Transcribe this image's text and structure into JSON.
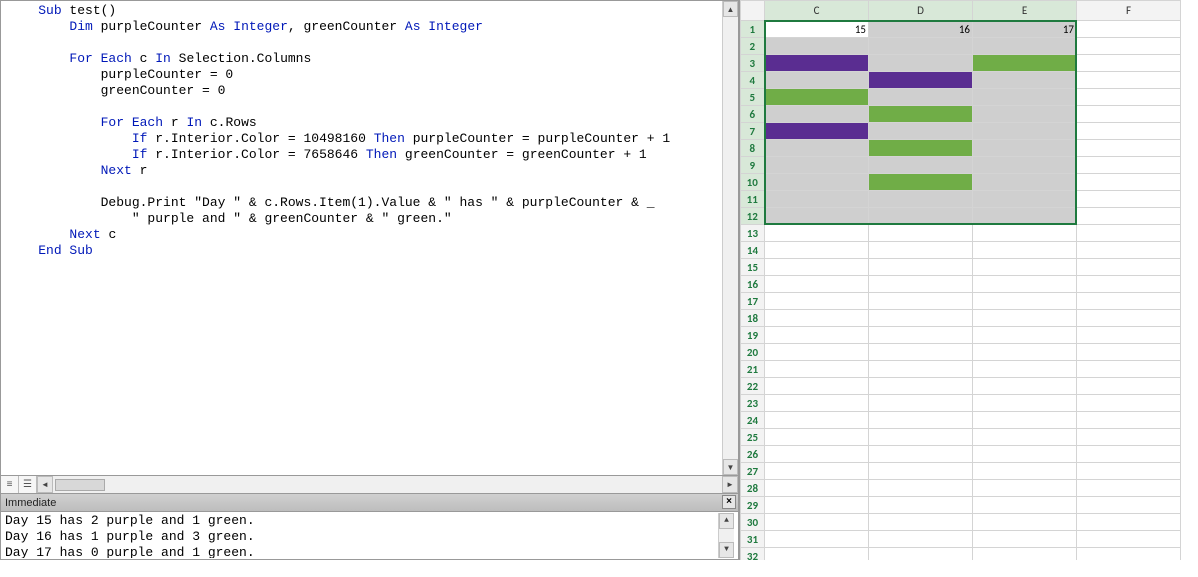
{
  "vba": {
    "code_tokens": [
      [
        "    ",
        "Sub",
        " test()"
      ],
      [
        "        ",
        "Dim",
        " purpleCounter ",
        "As Integer",
        ", greenCounter ",
        "As Integer"
      ],
      [
        ""
      ],
      [
        "        ",
        "For Each",
        " c ",
        "In",
        " Selection.Columns"
      ],
      [
        "            purpleCounter = 0"
      ],
      [
        "            greenCounter = 0"
      ],
      [
        ""
      ],
      [
        "            ",
        "For Each",
        " r ",
        "In",
        " c.Rows"
      ],
      [
        "                ",
        "If",
        " r.Interior.Color = 10498160 ",
        "Then",
        " purpleCounter = purpleCounter + 1"
      ],
      [
        "                ",
        "If",
        " r.Interior.Color = 7658646 ",
        "Then",
        " greenCounter = greenCounter + 1"
      ],
      [
        "            ",
        "Next",
        " r"
      ],
      [
        ""
      ],
      [
        "            Debug.Print \"Day \" & c.Rows.Item(1).Value & \" has \" & purpleCounter & _"
      ],
      [
        "                \" purple and \" & greenCounter & \" green.\""
      ],
      [
        "        ",
        "Next",
        " c"
      ],
      [
        "    ",
        "End Sub"
      ]
    ],
    "keywords": [
      "Sub",
      "Dim",
      "As Integer",
      "For Each",
      "In",
      "If",
      "Then",
      "Next",
      "End Sub"
    ]
  },
  "immediate": {
    "title": "Immediate",
    "lines": [
      "Day 15 has 2 purple and 1 green.",
      "Day 16 has 1 purple and 3 green.",
      "Day 17 has 0 purple and 1 green."
    ]
  },
  "sheet": {
    "columns": [
      "C",
      "D",
      "E",
      "F"
    ],
    "sel_cols": [
      "C",
      "D",
      "E"
    ],
    "row_count": 32,
    "sel_rows": [
      1,
      2,
      3,
      4,
      5,
      6,
      7,
      8,
      9,
      10,
      11,
      12
    ],
    "col_widths": {
      "C": 104,
      "D": 104,
      "E": 104,
      "F": 104
    },
    "cells": {
      "C1": {
        "v": "15",
        "fill": "sel",
        "active": true
      },
      "D1": {
        "v": "16",
        "fill": "sel"
      },
      "E1": {
        "v": "17",
        "fill": "sel"
      },
      "C2": {
        "fill": "sel"
      },
      "D2": {
        "fill": "sel"
      },
      "E2": {
        "fill": "sel"
      },
      "C3": {
        "fill": "purple"
      },
      "D3": {
        "fill": "sel"
      },
      "E3": {
        "fill": "green"
      },
      "C4": {
        "fill": "sel"
      },
      "D4": {
        "fill": "purple"
      },
      "E4": {
        "fill": "sel"
      },
      "C5": {
        "fill": "green"
      },
      "D5": {
        "fill": "sel"
      },
      "E5": {
        "fill": "sel"
      },
      "C6": {
        "fill": "sel"
      },
      "D6": {
        "fill": "green"
      },
      "E6": {
        "fill": "sel"
      },
      "C7": {
        "fill": "purple"
      },
      "D7": {
        "fill": "sel"
      },
      "E7": {
        "fill": "sel"
      },
      "C8": {
        "fill": "sel"
      },
      "D8": {
        "fill": "green"
      },
      "E8": {
        "fill": "sel"
      },
      "C9": {
        "fill": "sel"
      },
      "D9": {
        "fill": "sel"
      },
      "E9": {
        "fill": "sel"
      },
      "C10": {
        "fill": "sel"
      },
      "D10": {
        "fill": "green"
      },
      "E10": {
        "fill": "sel"
      },
      "C11": {
        "fill": "sel"
      },
      "D11": {
        "fill": "sel"
      },
      "E11": {
        "fill": "sel"
      },
      "C12": {
        "fill": "sel"
      },
      "D12": {
        "fill": "sel"
      },
      "E12": {
        "fill": "sel"
      }
    }
  }
}
